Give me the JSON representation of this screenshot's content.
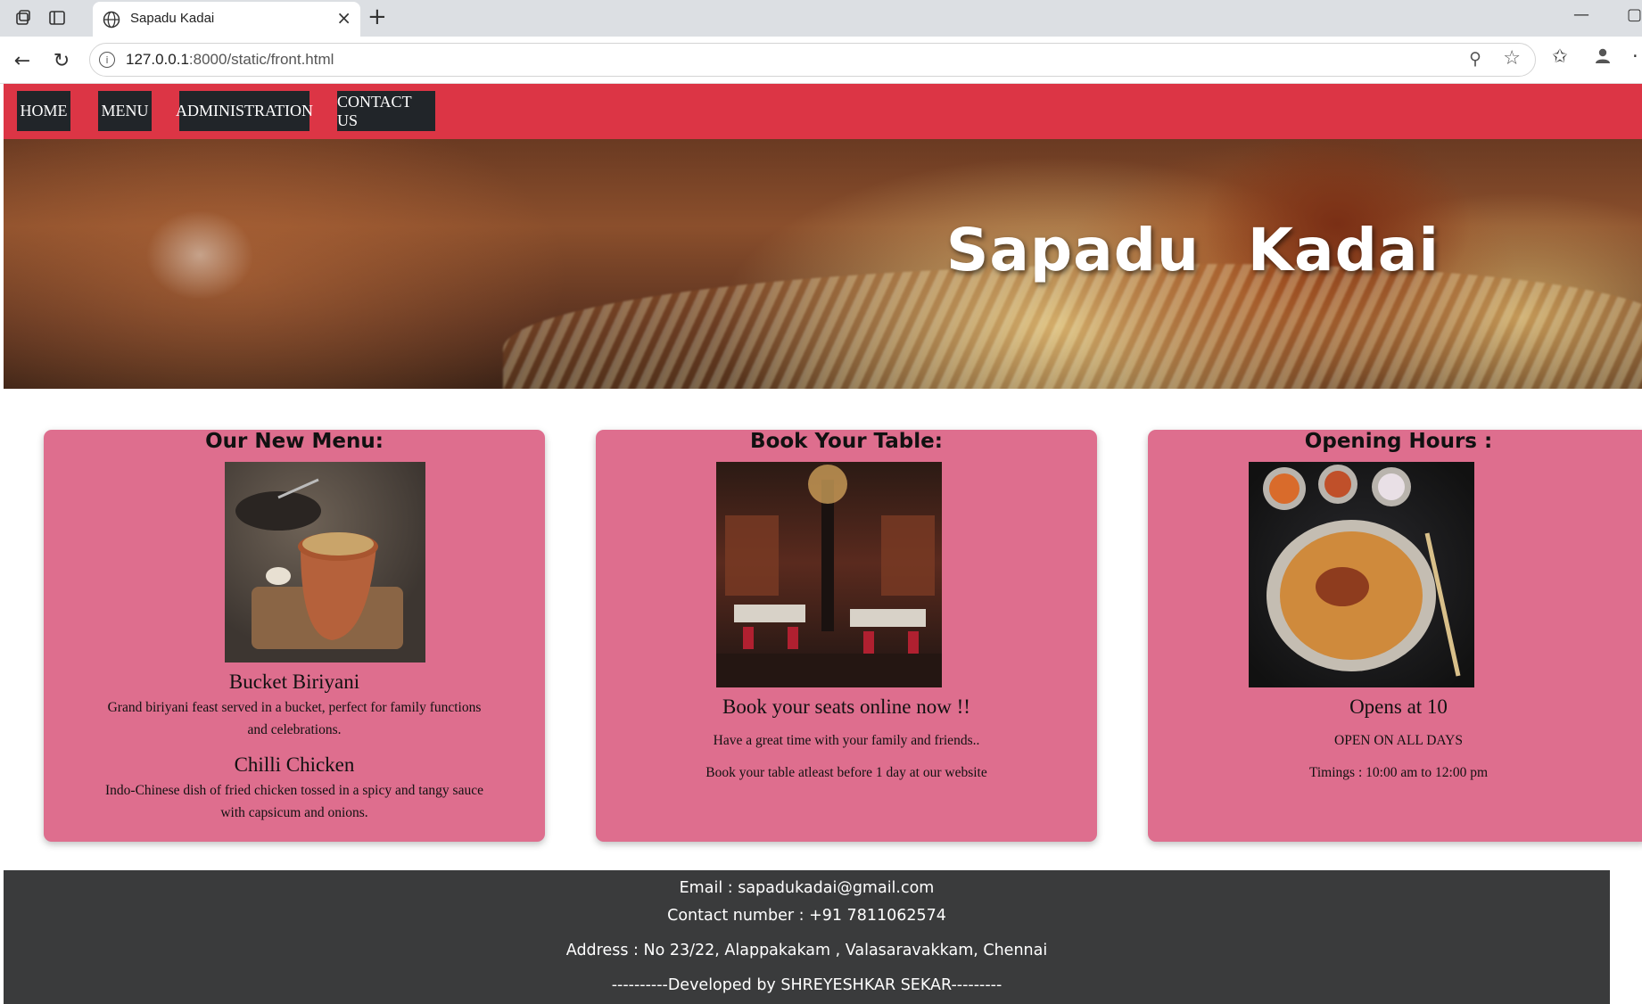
{
  "browser": {
    "tab_title": "Sapadu Kadai",
    "url_host": "127.0.0.1",
    "url_rest": ":8000/static/front.html"
  },
  "navbar": {
    "items": [
      "HOME",
      "MENU",
      "ADMINISTRATION",
      "CONTACT US"
    ],
    "color": "#dc3545"
  },
  "hero": {
    "title": "Sapadu Kadai"
  },
  "cards": {
    "menu": {
      "heading": "Our New Menu:",
      "dishes": [
        {
          "name": "Bucket Biriyani",
          "description": "Grand biriyani feast served in a bucket, perfect for family functions and celebrations."
        },
        {
          "name": "Chilli Chicken",
          "description": "Indo-Chinese dish of fried chicken tossed in a spicy and tangy sauce with capsicum and onions."
        }
      ]
    },
    "booking": {
      "heading": "Book Your Table:",
      "subheading": "Book your seats online now !!",
      "line1": "Have a great time with your family and friends..",
      "line2": "Book your table atleast before 1 day at our website"
    },
    "hours": {
      "heading": "Opening Hours :",
      "subheading": "Opens at 10",
      "line1": "OPEN ON ALL DAYS",
      "line2": "Timings : 10:00 am to 12:00 pm"
    },
    "color": "#de6e8e"
  },
  "footer": {
    "email": "Email : sapadukadai@gmail.com",
    "contact": "Contact number : +91 7811062574",
    "address": "Address : No 23/22, Alappakakam , Valasaravakkam, Chennai",
    "credit": "----------Developed by SHREYESHKAR SEKAR---------",
    "color": "#3a3b3c"
  }
}
